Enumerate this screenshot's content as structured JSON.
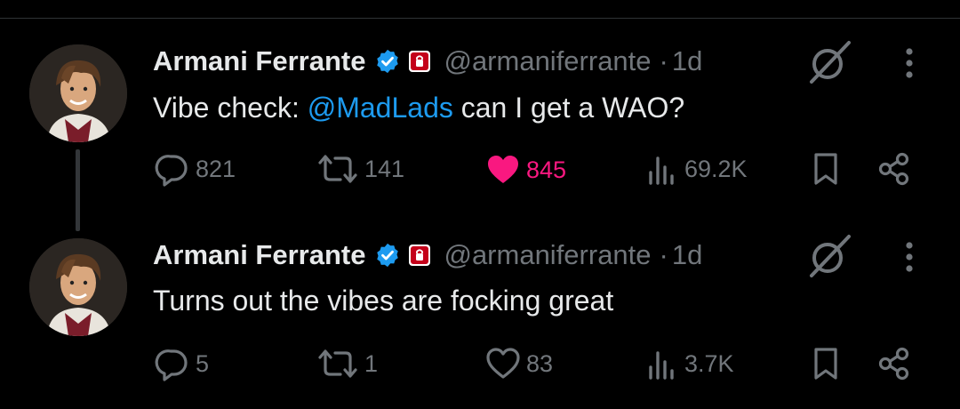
{
  "thread": [
    {
      "author_name": "Armani Ferrante",
      "handle": "@armaniferrante",
      "separator": "·",
      "time": "1d",
      "text_prefix": "Vibe check: ",
      "mention": "@MadLads",
      "text_suffix": " can I get a WAO?",
      "replies": "821",
      "reposts": "141",
      "likes": "845",
      "liked": true,
      "views": "69.2K"
    },
    {
      "author_name": "Armani Ferrante",
      "handle": "@armaniferrante",
      "separator": "·",
      "time": "1d",
      "text_prefix": "Turns out the vibes are focking great",
      "mention": "",
      "text_suffix": "",
      "replies": "5",
      "reposts": "1",
      "likes": "83",
      "liked": false,
      "views": "3.7K"
    }
  ],
  "icons": {
    "verified": "verified-badge-icon",
    "affiliation": "affiliation-badge-icon",
    "grok": "grok-icon",
    "more": "more-options-icon",
    "reply": "reply-icon",
    "repost": "repost-icon",
    "like": "like-icon",
    "views": "views-icon",
    "bookmark": "bookmark-icon",
    "share": "share-icon"
  },
  "colors": {
    "background": "#000000",
    "text": "#e7e9ea",
    "secondary": "#71767b",
    "accent": "#1d9bf0",
    "like": "#f91880",
    "affiliation_badge": "#c4001a"
  }
}
